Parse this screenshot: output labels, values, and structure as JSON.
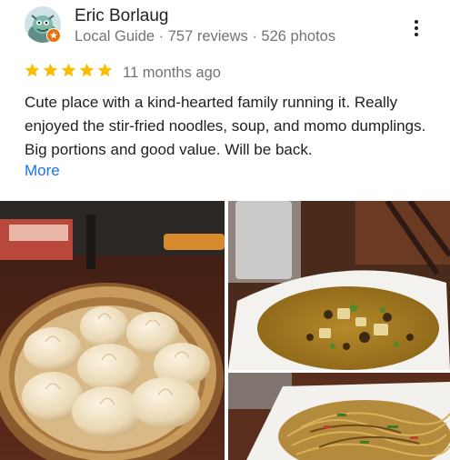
{
  "reviewer": {
    "name": "Eric Borlaug",
    "meta": "Local Guide · 757 reviews · 526 photos",
    "avatar_icon": "reviewer-avatar-icon",
    "badge_icon": "local-guide-badge-icon"
  },
  "rating": {
    "stars": 5,
    "max_stars": 5,
    "time_ago": "11 months ago",
    "star_color": "#fbbc04"
  },
  "review": {
    "text": "Cute place with a kind-hearted family running it. Really enjoyed the stir-fried noodles, soup, and momo dumplings. Big portions and good value. Will be back.",
    "more_label": "More"
  },
  "menu": {
    "icon": "more-vert-icon"
  },
  "colors": {
    "link": "#1a73e8",
    "secondary_text": "#70757a",
    "primary_text": "#202124"
  },
  "photos": [
    {
      "subject": "momo-dumplings-photo"
    },
    {
      "subject": "soup-bowl-photo"
    },
    {
      "subject": "stir-fried-noodles-photo"
    }
  ]
}
